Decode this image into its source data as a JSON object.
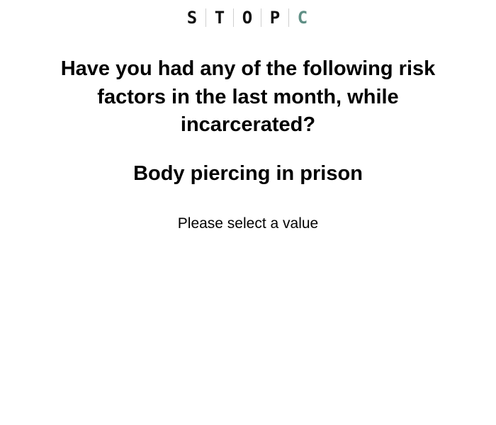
{
  "logo": {
    "letters": [
      "S",
      "T",
      "O",
      "P",
      "C"
    ],
    "accent_color": "#5f8f85"
  },
  "question": {
    "text": "Have you had any of the following risk factors in the last month, while incarcerated?"
  },
  "risk_factor": {
    "text": "Body piercing in prison"
  },
  "prompt": {
    "text": "Please select a value"
  }
}
